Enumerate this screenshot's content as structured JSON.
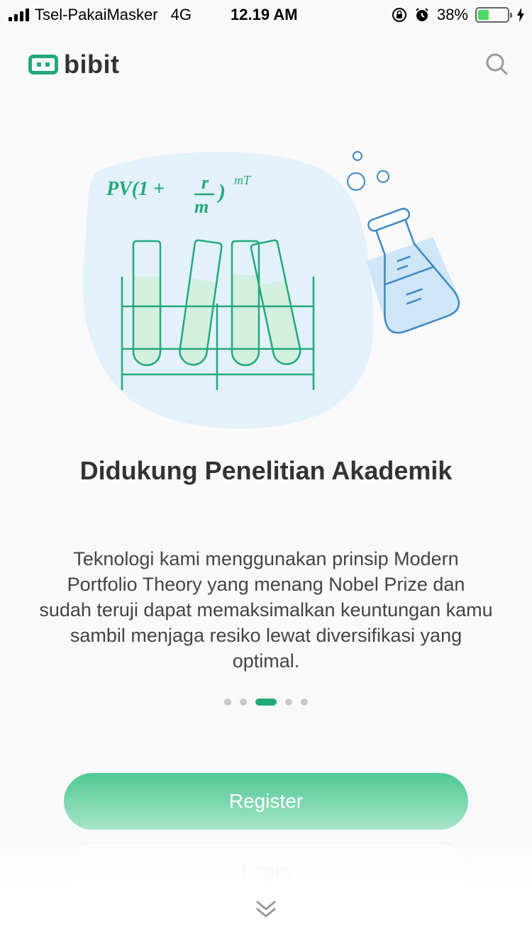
{
  "status_bar": {
    "carrier": "Tsel-PakaiMasker",
    "network": "4G",
    "time": "12.19 AM",
    "battery": "38%",
    "battery_level": 0.38
  },
  "header": {
    "brand": "bibit",
    "brand_color": "#22a978"
  },
  "illustration": {
    "formula_main": "PV(1 +",
    "formula_numerator": "r",
    "formula_denominator": "m",
    "formula_close": ")",
    "formula_exponent": "mT"
  },
  "onboarding": {
    "title": "Didukung Penelitian Akademik",
    "description": "Teknologi kami menggunakan prinsip Modern Portfolio Theory yang menang Nobel Prize dan sudah teruji dapat memaksimalkan keuntungan kamu sambil menjaga resiko lewat diversifikasi yang optimal.",
    "pages": 5,
    "current_page": 3
  },
  "actions": {
    "register": "Register",
    "login": "Login"
  },
  "icons": {
    "search": "search-icon",
    "logo": "bibit-logo-icon",
    "scroll": "chevron-down-icon"
  }
}
